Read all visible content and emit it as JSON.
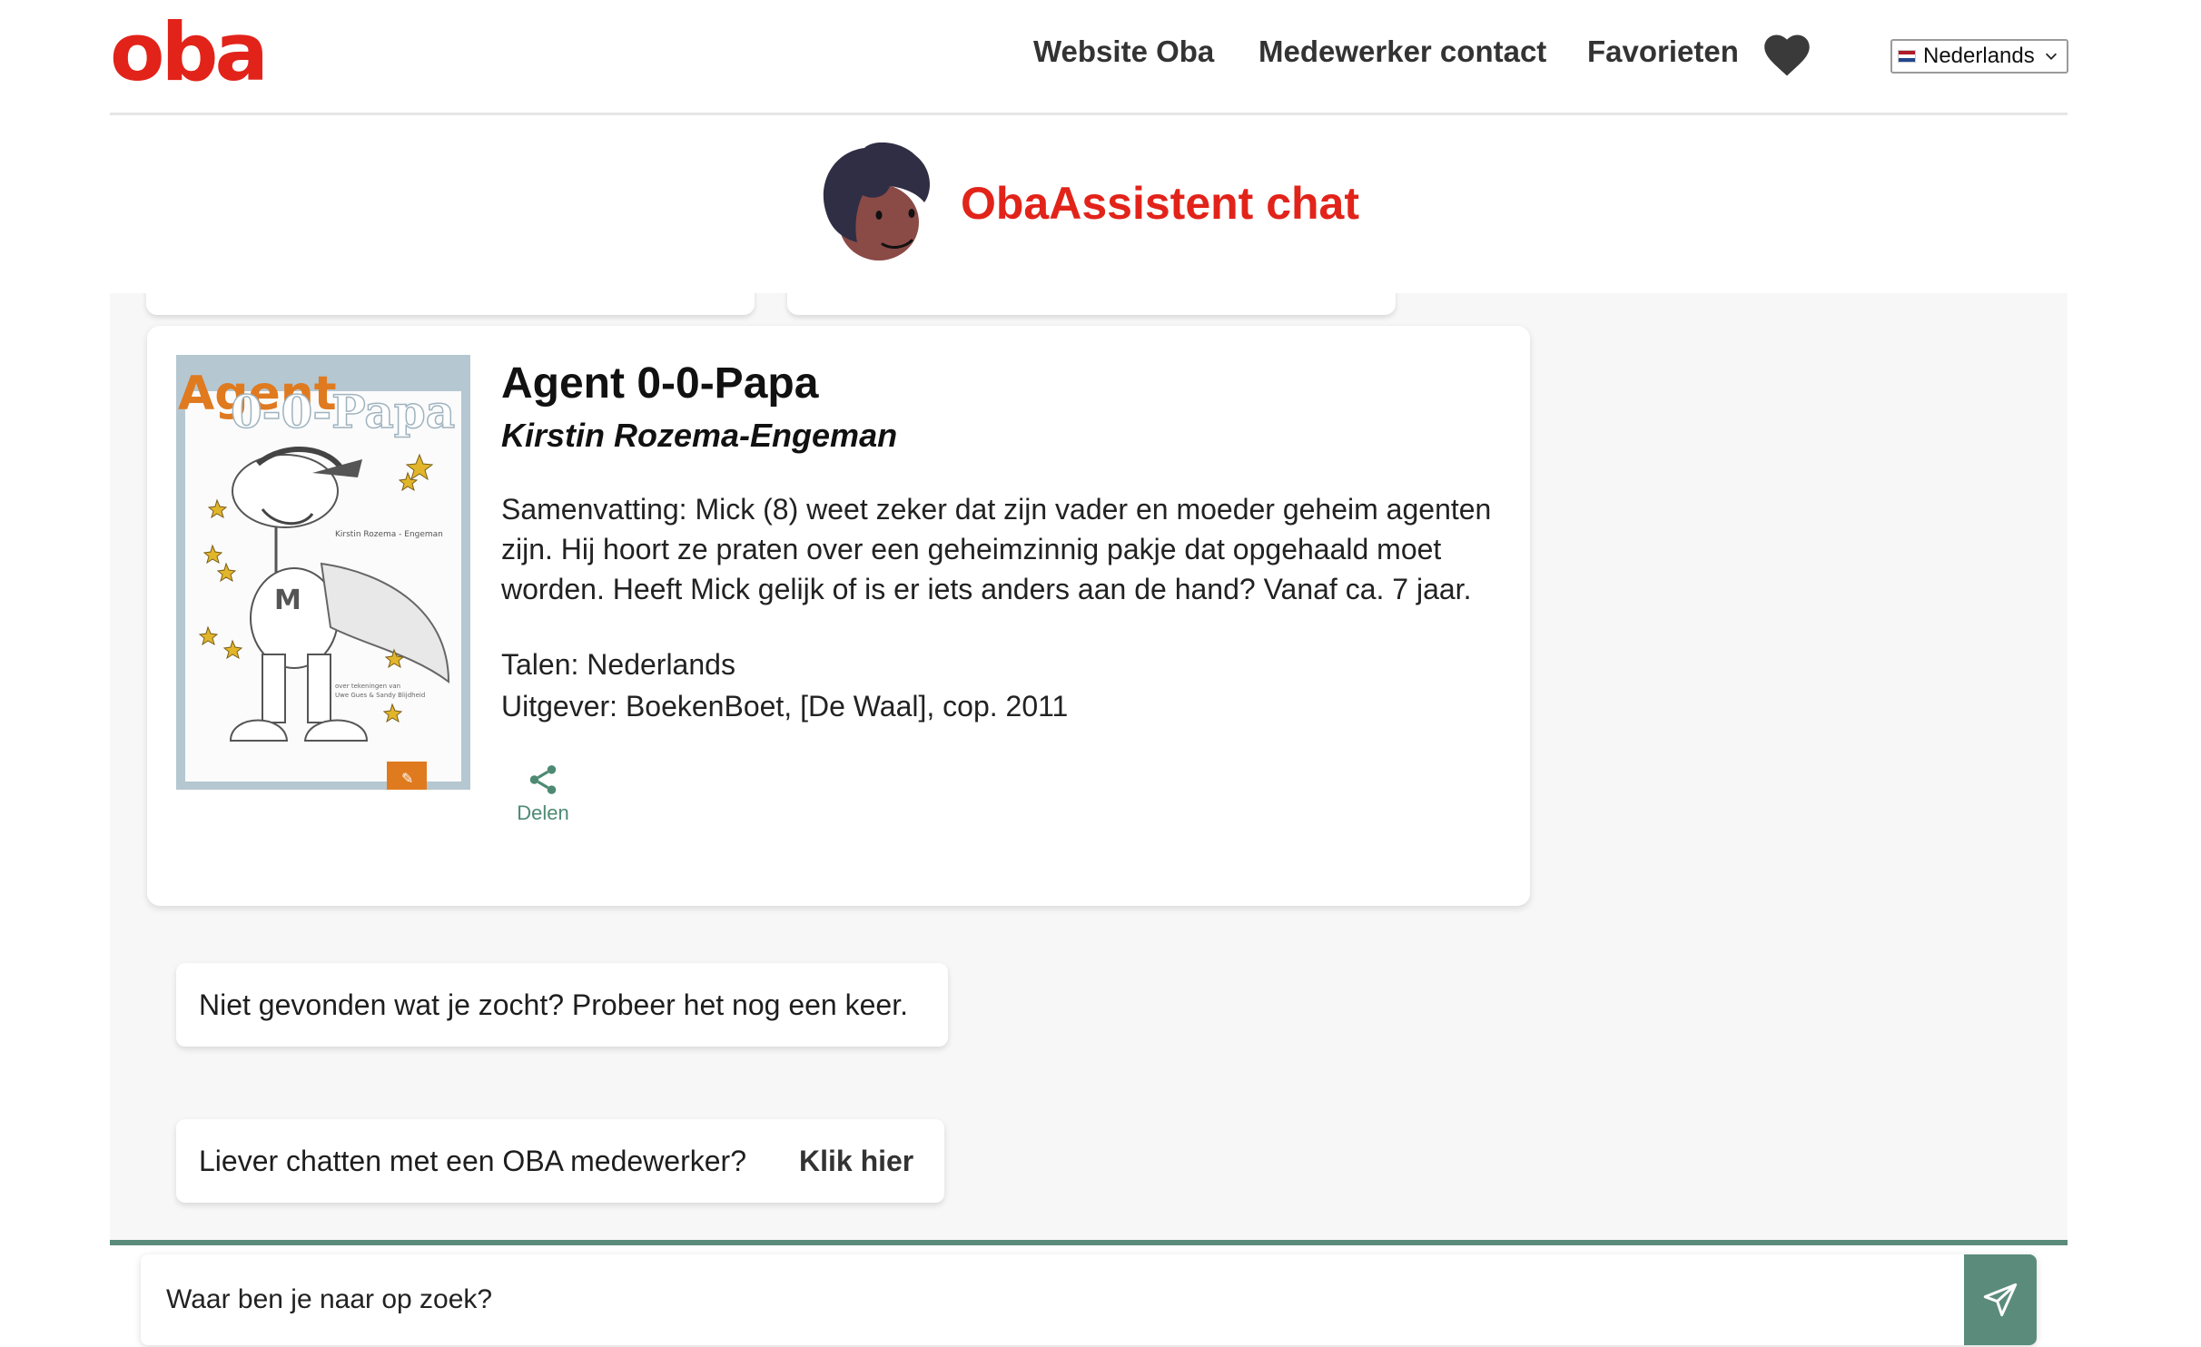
{
  "header": {
    "logo_text": "oba",
    "nav": [
      {
        "label": "Website Oba"
      },
      {
        "label": "Medewerker contact"
      },
      {
        "label": "Favorieten"
      }
    ],
    "language": {
      "selected": "Nederlands"
    }
  },
  "chat": {
    "title": "ObaAssistent chat"
  },
  "book": {
    "cover_title": "Agent 0-0-Papa",
    "cover_author": "Kirstin Rozema - Engeman",
    "title": "Agent 0-0-Papa",
    "author": "Kirstin Rozema-Engeman",
    "summary": "Samenvatting: Mick (8) weet zeker dat zijn vader en moeder geheim agenten zijn. Hij hoort ze praten over een geheimzinnig pakje dat opgehaald moet worden. Heeft Mick gelijk of is er iets anders aan de hand? Vanaf ca. 7 jaar.",
    "languages": "Talen: Nederlands",
    "publisher": "Uitgever: BoekenBoet, [De Waal], cop. 2011",
    "share_label": "Delen"
  },
  "messages": {
    "not_found": "Niet gevonden wat je zocht? Probeer het nog een keer.",
    "chat_employee": "Liever chatten met een OBA medewerker?",
    "click_here": "Klik hier"
  },
  "input": {
    "placeholder": "Waar ben je naar op zoek?"
  },
  "colors": {
    "brand_red": "#e2231a",
    "accent_green": "#5b8c7b"
  }
}
